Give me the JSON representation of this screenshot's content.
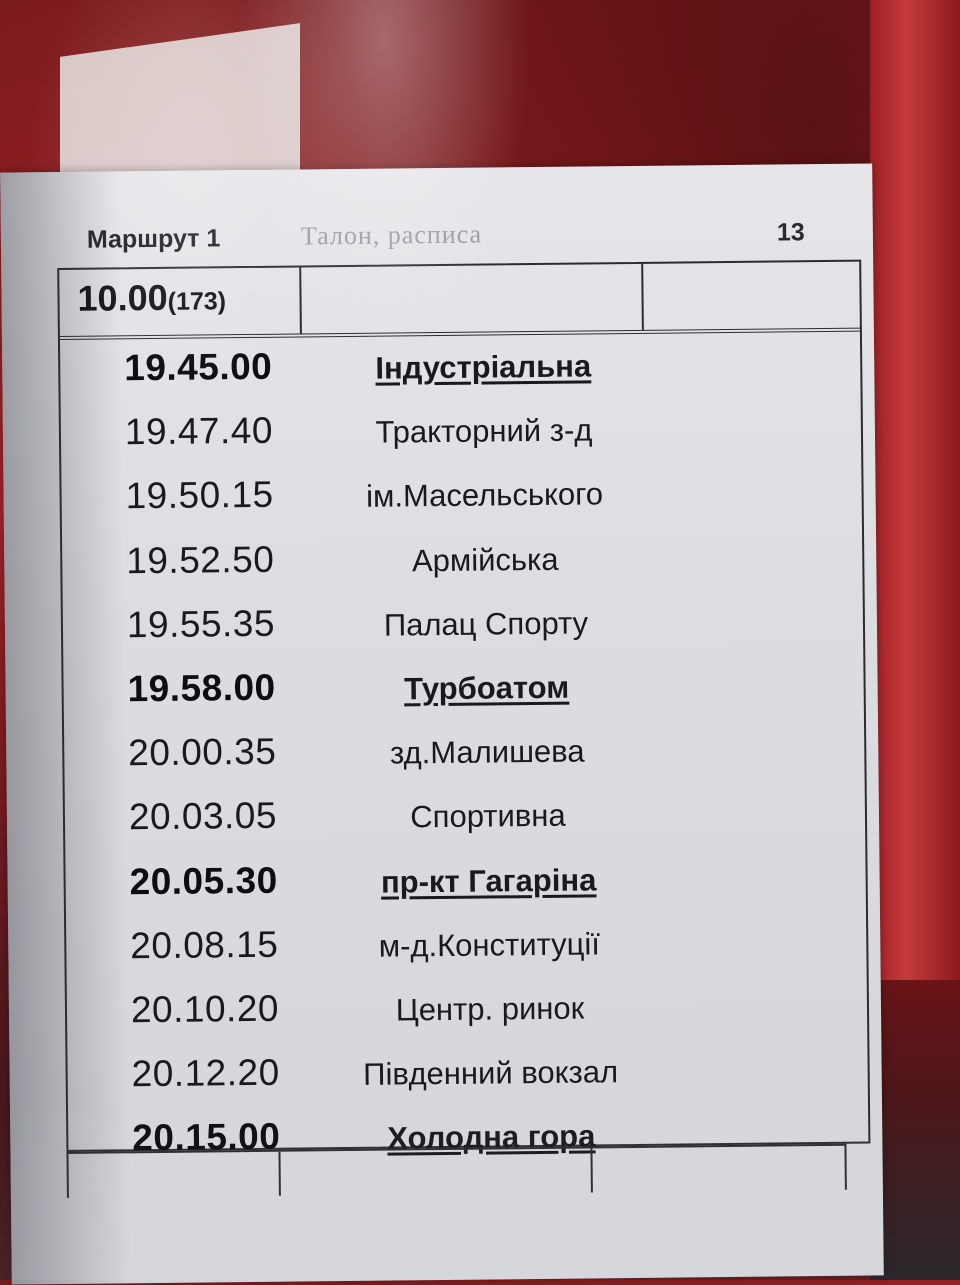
{
  "header": {
    "route_label": "Маршрут  1",
    "ticket_title": "Талон, расписа",
    "number": "13"
  },
  "departure": {
    "time": "10.00",
    "code": "(173)"
  },
  "schedule": [
    {
      "time": "19.45.00",
      "stop": "Індустріальна",
      "major": true
    },
    {
      "time": "19.47.40",
      "stop": "Тракторний з-д",
      "major": false
    },
    {
      "time": "19.50.15",
      "stop": "ім.Масельського",
      "major": false
    },
    {
      "time": "19.52.50",
      "stop": "Армійська",
      "major": false
    },
    {
      "time": "19.55.35",
      "stop": "Палац Спорту",
      "major": false
    },
    {
      "time": "19.58.00",
      "stop": "Турбоатом",
      "major": true
    },
    {
      "time": "20.00.35",
      "stop": "зд.Малишева",
      "major": false
    },
    {
      "time": "20.03.05",
      "stop": "Спортивна",
      "major": false
    },
    {
      "time": "20.05.30",
      "stop": "пр-кт Гагаріна",
      "major": true
    },
    {
      "time": "20.08.15",
      "stop": "м-д.Конституції",
      "major": false
    },
    {
      "time": "20.10.20",
      "stop": "Центр. ринок",
      "major": false
    },
    {
      "time": "20.12.20",
      "stop": "Південний вокзал",
      "major": false
    },
    {
      "time": "20.15.00",
      "stop": "Холодна гора",
      "major": true
    }
  ]
}
